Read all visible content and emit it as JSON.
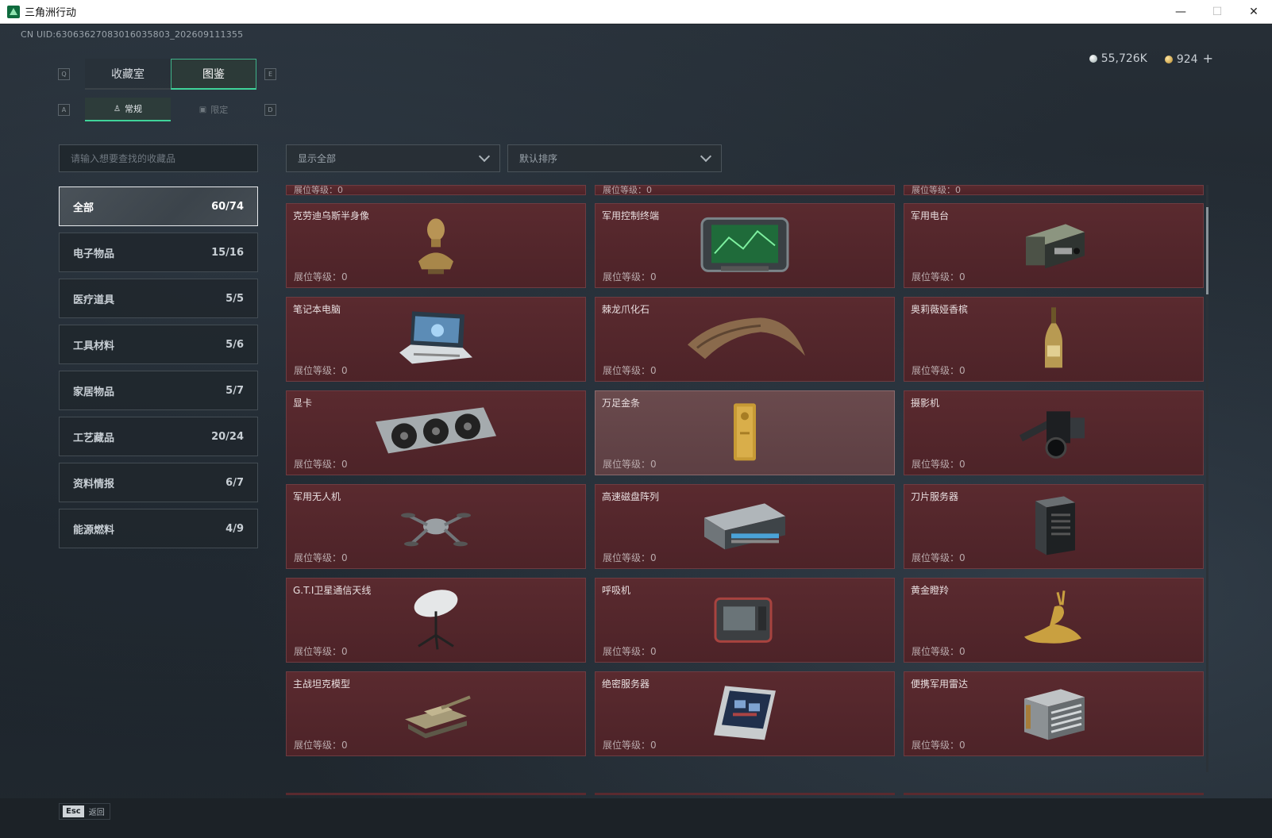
{
  "window": {
    "title": "三角洲行动",
    "minimize": "—",
    "maximize": "☐",
    "close": "✕"
  },
  "uid": "CN UID:6306362708301603​5803_202609111355",
  "currency": {
    "silver": "55,726K",
    "gold": "924",
    "plus": "+"
  },
  "keys": {
    "q": "Q",
    "e": "E",
    "a": "A",
    "d": "D"
  },
  "tabs": {
    "collection_room": "收藏室",
    "catalog": "图鉴"
  },
  "subtabs": {
    "regular": "常规",
    "limited": "限定"
  },
  "search": {
    "placeholder": "请输入想要查找的收藏品"
  },
  "filters": {
    "show": "显示全部",
    "sort": "默认排序"
  },
  "categories": [
    {
      "label": "全部",
      "count": "60/74"
    },
    {
      "label": "电子物品",
      "count": "15/16"
    },
    {
      "label": "医疗道具",
      "count": "5/5"
    },
    {
      "label": "工具材料",
      "count": "5/6"
    },
    {
      "label": "家居物品",
      "count": "5/7"
    },
    {
      "label": "工艺藏品",
      "count": "20/24"
    },
    {
      "label": "资料情报",
      "count": "6/7"
    },
    {
      "label": "能源燃料",
      "count": "4/9"
    }
  ],
  "level_label": "展位等级：0",
  "items": [
    {
      "name": "克劳迪乌斯半身像",
      "icon": "bust-icon"
    },
    {
      "name": "军用控制终端",
      "icon": "terminal-icon"
    },
    {
      "name": "军用电台",
      "icon": "radio-icon"
    },
    {
      "name": "笔记本电脑",
      "icon": "laptop-icon"
    },
    {
      "name": "棘龙爪化石",
      "icon": "claw-fossil-icon"
    },
    {
      "name": "奥莉薇娅香槟",
      "icon": "champagne-icon"
    },
    {
      "name": "显卡",
      "icon": "gpu-icon"
    },
    {
      "name": "万足金条",
      "icon": "gold-bar-icon"
    },
    {
      "name": "摄影机",
      "icon": "camera-icon"
    },
    {
      "name": "军用无人机",
      "icon": "drone-icon"
    },
    {
      "name": "高速磁盘阵列",
      "icon": "disk-array-icon"
    },
    {
      "name": "刀片服务器",
      "icon": "blade-server-icon"
    },
    {
      "name": "G.T.I卫星通信天线",
      "icon": "satellite-dish-icon"
    },
    {
      "name": "呼吸机",
      "icon": "ventilator-icon"
    },
    {
      "name": "黄金瞪羚",
      "icon": "gazelle-icon"
    },
    {
      "name": "主战坦克模型",
      "icon": "tank-icon"
    },
    {
      "name": "绝密服务器",
      "icon": "server-board-icon"
    },
    {
      "name": "便携军用雷达",
      "icon": "radar-icon"
    }
  ],
  "colors": {
    "accent": "#3fd39a",
    "card_bg": "#55272c"
  },
  "footer": {
    "esc_key": "Esc",
    "back": "返回"
  }
}
